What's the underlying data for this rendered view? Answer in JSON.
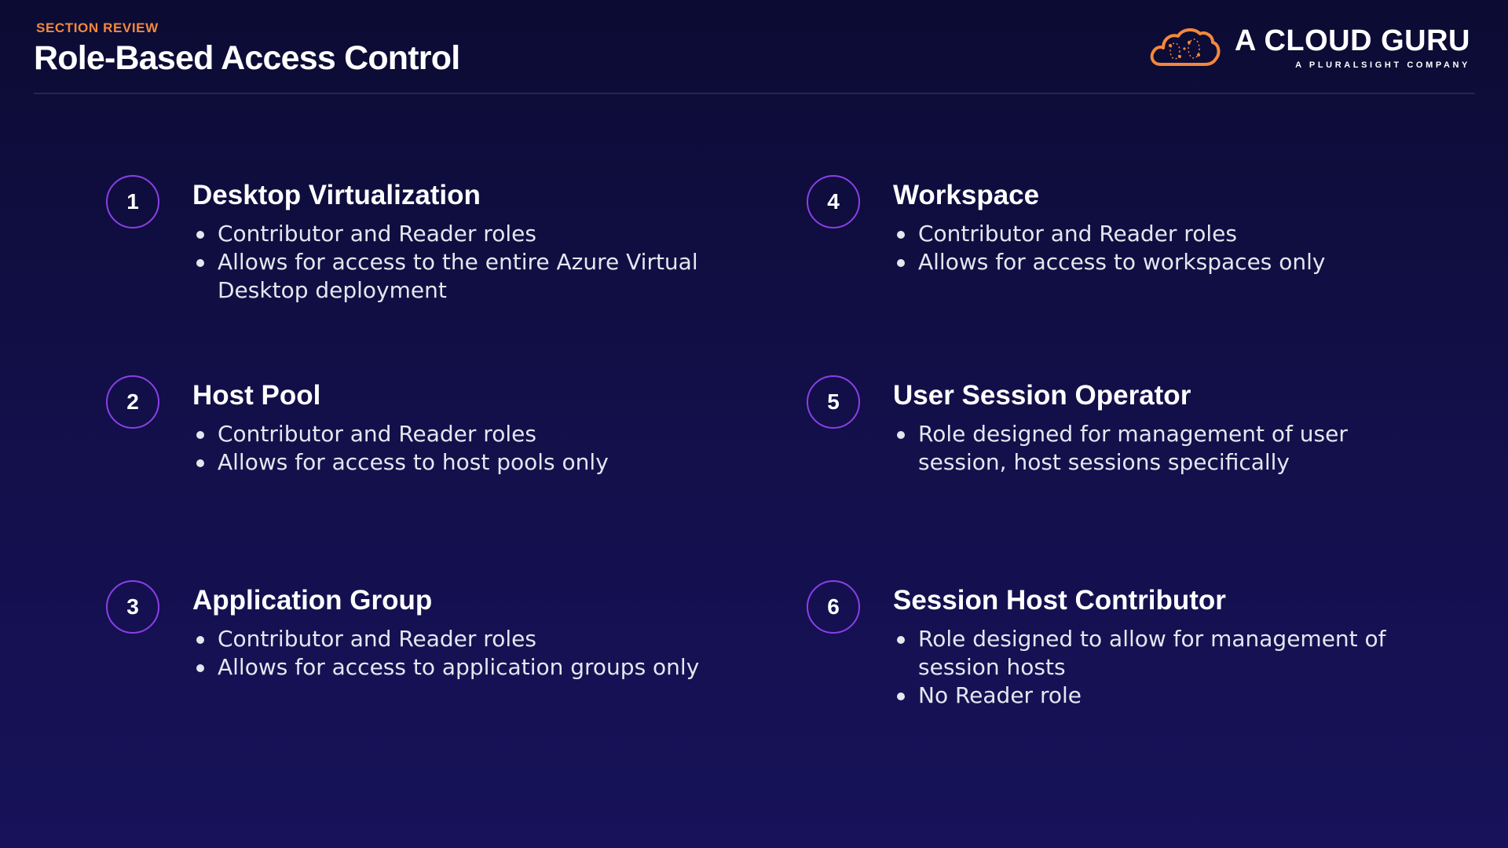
{
  "header": {
    "kicker": "SECTION REVIEW",
    "title": "Role-Based Access Control"
  },
  "logo": {
    "icon": "cloud-icon",
    "name": "A CLOUD GURU",
    "tagline": "A PLURALSIGHT COMPANY",
    "color": "#f3883b"
  },
  "colors": {
    "accent": "#f3883b",
    "circle_border": "#8b3fe8",
    "background_top": "#0c0b33",
    "background_bottom": "#17125a"
  },
  "items": [
    {
      "number": "1",
      "title": "Desktop Virtualization",
      "bullets": [
        "Contributor and Reader roles",
        "Allows for access to the entire Azure Virtual Desktop deployment"
      ]
    },
    {
      "number": "2",
      "title": "Host Pool",
      "bullets": [
        "Contributor and Reader roles",
        "Allows for access to host pools only"
      ]
    },
    {
      "number": "3",
      "title": "Application Group",
      "bullets": [
        "Contributor and Reader roles",
        "Allows for access to application groups only"
      ]
    },
    {
      "number": "4",
      "title": "Workspace",
      "bullets": [
        "Contributor and Reader roles",
        "Allows for access to workspaces only"
      ]
    },
    {
      "number": "5",
      "title": "User Session Operator",
      "bullets": [
        "Role designed for management of user session, host sessions specifically"
      ]
    },
    {
      "number": "6",
      "title": "Session Host Contributor",
      "bullets": [
        "Role designed to allow for management of session hosts",
        "No Reader role"
      ]
    }
  ]
}
